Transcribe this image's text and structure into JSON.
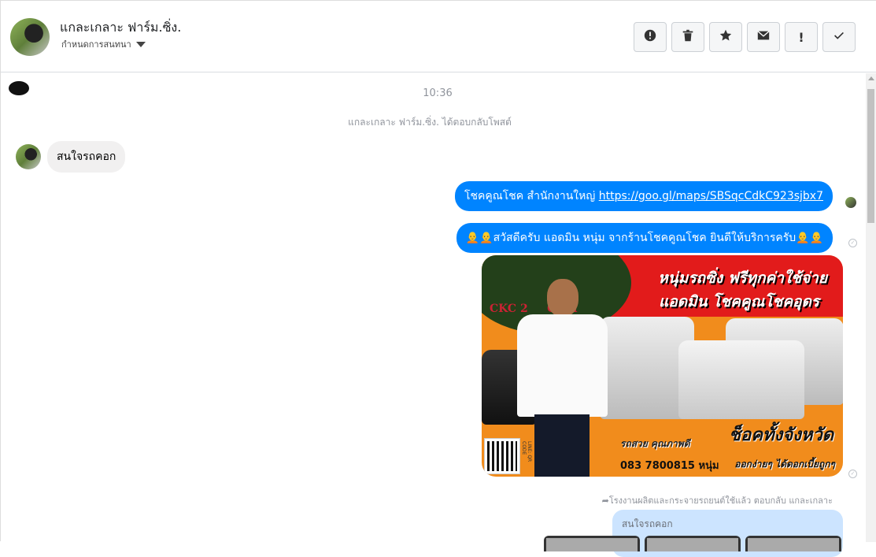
{
  "header": {
    "contact_name": "แกละเกลาะ ฟาร์ม.ซิ่ง.",
    "subtitle": "กำหนดการสนทนา",
    "tools": [
      {
        "name": "report-icon",
        "label": ""
      },
      {
        "name": "trash-icon",
        "label": ""
      },
      {
        "name": "star-icon",
        "label": ""
      },
      {
        "name": "envelope-icon",
        "label": ""
      },
      {
        "name": "exclamation-icon",
        "label": "!"
      },
      {
        "name": "check-icon",
        "label": ""
      }
    ]
  },
  "conversation": {
    "time": "10:36",
    "system_message": "แกละเกลาะ ฟาร์ม.ซิ่ง. ได้ตอบกลับโพสต์",
    "incoming_message": "สนใจรถคอก",
    "outgoing": [
      {
        "prefix": "โชคคูณโชค สำนักงานใหญ่ ",
        "link": "https://goo.gl/maps/SBSqcCdkC923sjbx7"
      },
      {
        "text": "🧑‍🦲🧑‍🦲สวัสดีครับ แอดมิน หนุ่ม จากร้านโชคคูณโชค ยินดีให้บริการครับ🧑‍🦲🧑‍🦲"
      }
    ],
    "image": {
      "brand": "CKC 2 ... COM",
      "headline1": "หนุ่มรถซิ่ง ฟรีทุกค่าใช้จ่าย",
      "headline2": "แอดมิน โชคคูณโชคอุดร",
      "big_text": "ช็อคทั้งจังหวัด",
      "sub_text": "รถสวย คุณภาพดี",
      "phone": "083 7800815 หนุ่ม",
      "tagline": "ออกง่ายๆ ได้ดอกเบี้ยถูกๆ",
      "qr_label": "LINE: QR CODE"
    },
    "reply_label": "โรงงานผลิตและกระจายรถยนต์ใช้แล้ว ตอบกลับ แกละเกลาะ",
    "quoted_text": "สนใจรถคอก"
  }
}
